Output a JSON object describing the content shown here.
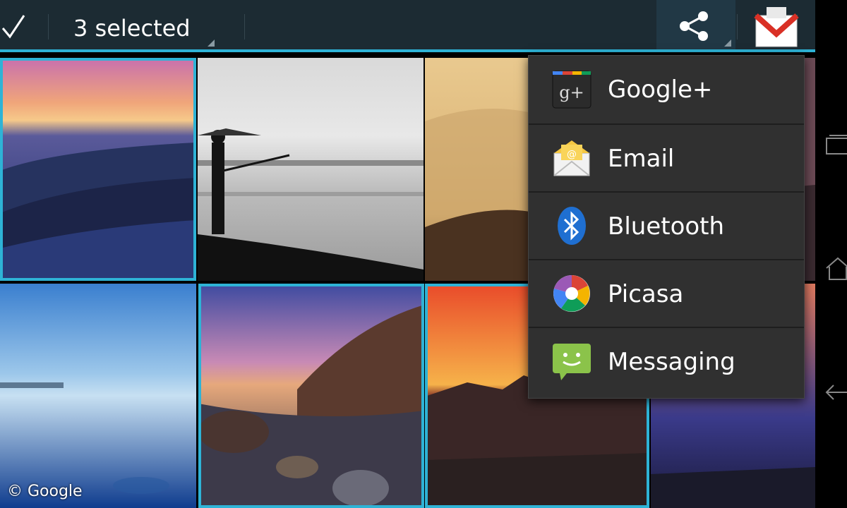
{
  "action_bar": {
    "selection_label": "3 selected",
    "accent_color": "#2eb3d6",
    "done_icon": "checkmark-icon",
    "share_icon": "share-icon",
    "gmail_icon": "gmail-icon"
  },
  "share_menu": {
    "items": [
      {
        "label": "Google+",
        "icon": "google-plus-icon"
      },
      {
        "label": "Email",
        "icon": "email-icon"
      },
      {
        "label": "Bluetooth",
        "icon": "bluetooth-icon"
      },
      {
        "label": "Picasa",
        "icon": "picasa-icon"
      },
      {
        "label": "Messaging",
        "icon": "messaging-icon"
      }
    ]
  },
  "photos": {
    "selected": [
      "photo-rocky-sunset-shore",
      "photo-rocky-cove",
      "photo-mountain-sunset"
    ]
  },
  "nav_bar": {
    "icons": [
      "recent-apps-icon",
      "home-icon",
      "back-icon"
    ]
  },
  "copyright": "© Google"
}
